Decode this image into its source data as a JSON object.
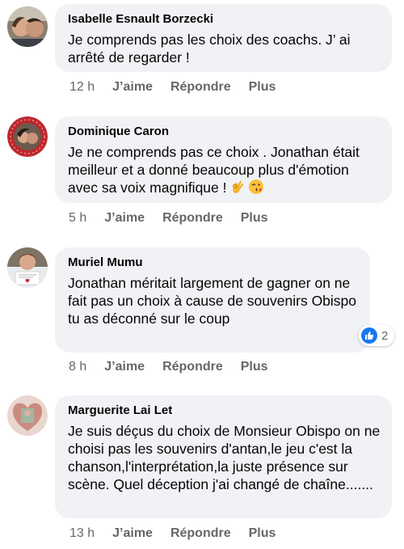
{
  "colors": {
    "bubble": "#f0f2f5",
    "meta": "#65676b",
    "like_blue": "#1877f2"
  },
  "comments": [
    {
      "author": "Isabelle Esnault Borzecki",
      "text": "Je comprends pas les choix des coachs. J’ ai arrêté de regarder !",
      "time": "12 h",
      "like": "J’aime",
      "reply": "Répondre",
      "more": "Plus"
    },
    {
      "author": "Dominique Caron",
      "text": "Je ne comprends pas ce choix . Jonathan était meilleur et a donné beaucoup plus d'émotion avec sa voix magnifique !",
      "emojis": [
        "ok-hand-icon",
        "kiss-face-icon"
      ],
      "time": "5 h",
      "like": "J’aime",
      "reply": "Répondre",
      "more": "Plus"
    },
    {
      "author": "Muriel Mumu",
      "text": "Jonathan méritait largement de gagner on ne fait pas un choix à cause de souvenirs Obispo tu as déconné sur le coup",
      "reaction_count": "2",
      "time": "8 h",
      "like": "J’aime",
      "reply": "Répondre",
      "more": "Plus"
    },
    {
      "author": "Marguerite Lai Let",
      "text": "Je suis déçus du choix de Monsieur Obispo on ne choisi pas les souvenirs d'antan,le jeu c'est la chanson,l'interprétation,la juste présence sur scène. Quel déception j'ai changé de chaîne.......",
      "time": "13 h",
      "like": "J’aime",
      "reply": "Répondre",
      "more": "Plus"
    }
  ]
}
